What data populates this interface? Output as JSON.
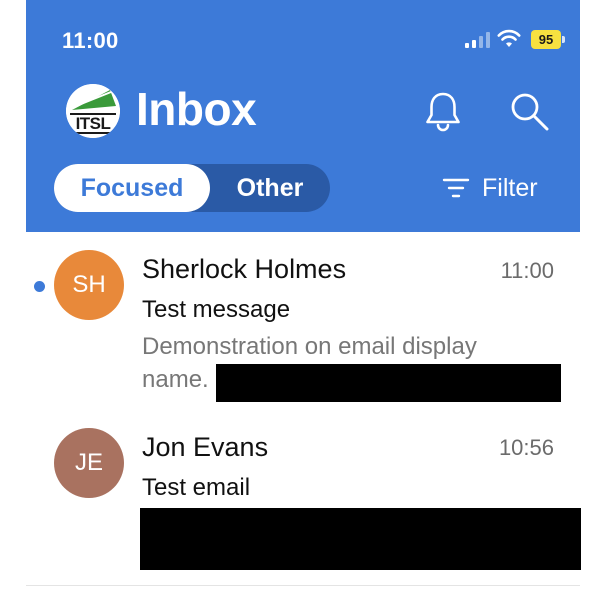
{
  "status_bar": {
    "time": "11:00",
    "battery": "95",
    "battery_color": "#f6e140",
    "icons": [
      "signal-icon",
      "wifi-icon",
      "battery-icon"
    ]
  },
  "header": {
    "logo_text": "ITSL",
    "title": "Inbox",
    "color": "#3d7ad8",
    "icons": [
      "bell-icon",
      "search-icon"
    ]
  },
  "tabs": {
    "focused": "Focused",
    "other": "Other",
    "selected": "Focused"
  },
  "filter": {
    "label": "Filter",
    "icon": "filter-icon"
  },
  "messages": [
    {
      "initials": "SH",
      "avatar_color": "#e8893a",
      "sender": "Sherlock Holmes",
      "time": "11:00",
      "subject": "Test message",
      "preview_line1": "Demonstration on email display",
      "preview_line2": "name.",
      "unread": true
    },
    {
      "initials": "JE",
      "avatar_color": "#a97260",
      "sender": "Jon Evans",
      "time": "10:56",
      "subject": "Test email",
      "unread": false
    }
  ]
}
